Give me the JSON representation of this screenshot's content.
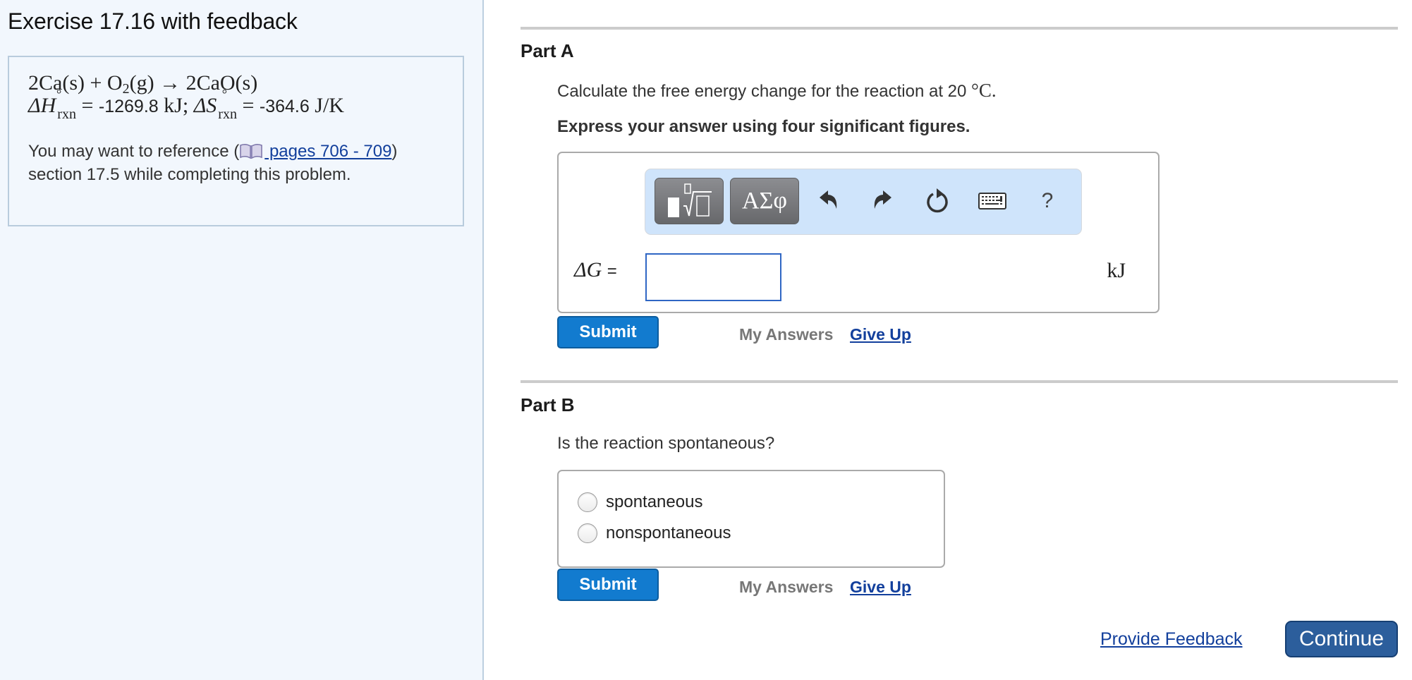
{
  "exercise": {
    "title": "Exercise 17.16 with feedback"
  },
  "info": {
    "reaction": {
      "reactant1": "2Ca(s)",
      "plus": "+",
      "reactant2_main": "O",
      "reactant2_sub": "2",
      "reactant2_state": "(g)",
      "arrow": "→",
      "product": "2CaO(s)"
    },
    "thermo": {
      "delta_h_symbol": "ΔH",
      "delta_h_sub": "rxn",
      "degree": "°",
      "equals": "=",
      "delta_h_value": "-1269.8",
      "delta_h_unit": "kJ;",
      "delta_s_symbol": "ΔS",
      "delta_s_sub": "rxn",
      "delta_s_value": "-364.6",
      "delta_s_unit": "J/K"
    },
    "reference": {
      "prefix": "You may want to reference (",
      "link_text": " pages 706 - 709",
      "suffix": ") section 17.5 while completing this problem.",
      "icon": "book-icon"
    }
  },
  "part_a": {
    "heading": "Part A",
    "question_prefix": "Calculate the free energy change for the reaction at 20 ",
    "question_temp_unit": "°C.",
    "instruction": "Express your answer using four significant figures.",
    "toolbar": {
      "templates_label": "templates",
      "symbols_label": "ΑΣφ",
      "undo_icon": "undo-icon",
      "redo_icon": "redo-icon",
      "reset_icon": "reset-icon",
      "keyboard_icon": "keyboard-icon",
      "help_label": "?"
    },
    "variable_label": "ΔG",
    "equals_label": "=",
    "input_value": "",
    "unit": "kJ",
    "submit_label": "Submit",
    "my_answers_label": "My Answers",
    "give_up_label": "Give Up"
  },
  "part_b": {
    "heading": "Part B",
    "question": "Is the reaction spontaneous?",
    "options": [
      {
        "label": "spontaneous",
        "selected": false
      },
      {
        "label": "nonspontaneous",
        "selected": false
      }
    ],
    "submit_label": "Submit",
    "my_answers_label": "My Answers",
    "give_up_label": "Give Up"
  },
  "footer": {
    "feedback_label": "Provide Feedback",
    "continue_label": "Continue"
  },
  "colors": {
    "submit_blue": "#127bcf",
    "continue_blue": "#2c5e9c",
    "link_blue": "#123f9c",
    "toolbar_bg": "#cfe4fb",
    "panel_bg": "#f2f7fd",
    "input_border": "#2f66c4"
  }
}
